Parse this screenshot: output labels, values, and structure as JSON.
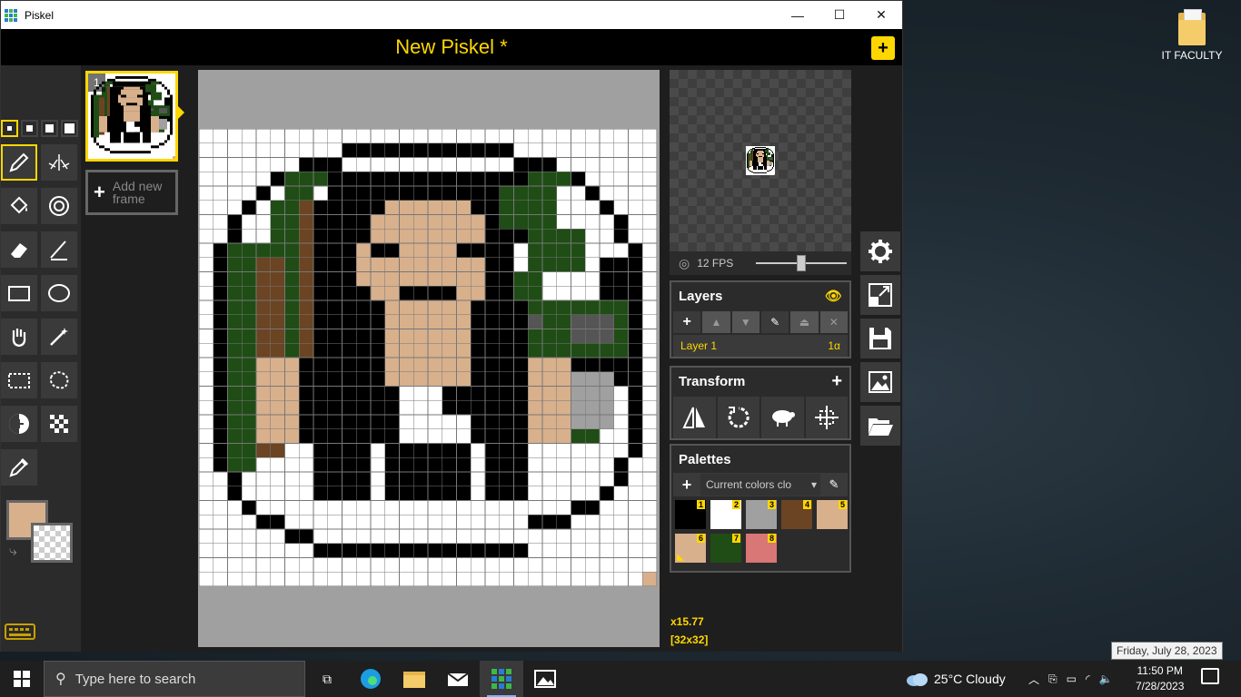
{
  "window": {
    "app_title": "Piskel",
    "minimize": "—",
    "maximize": "☐",
    "close": "✕"
  },
  "header": {
    "title": "New Piskel *",
    "new_button": "+"
  },
  "frames": {
    "frame_number": "1",
    "add_frame_label_1": "Add new",
    "add_frame_label_2": "frame"
  },
  "colors": {
    "primary": "#d8b08c",
    "secondary": "transparent"
  },
  "preview": {
    "fps_label": "12 FPS"
  },
  "layers": {
    "title": "Layers",
    "layer_name": "Layer 1",
    "layer_alpha": "1α"
  },
  "transform": {
    "title": "Transform"
  },
  "palettes": {
    "title": "Palettes",
    "selected": "Current colors clo",
    "swatches": [
      {
        "n": "1",
        "color": "#000000"
      },
      {
        "n": "2",
        "color": "#ffffff"
      },
      {
        "n": "3",
        "color": "#a0a0a0"
      },
      {
        "n": "4",
        "color": "#6b4423"
      },
      {
        "n": "5",
        "color": "#d8b08c"
      },
      {
        "n": "6",
        "color": "#d8b08c"
      },
      {
        "n": "7",
        "color": "#1f4d15"
      },
      {
        "n": "8",
        "color": "#d97676"
      }
    ]
  },
  "status": {
    "zoom": "x15.77",
    "size": "[32x32]"
  },
  "desktop": {
    "icon_label": "IT FACULTY"
  },
  "taskbar": {
    "search_placeholder": "Type here to search",
    "weather": "25°C  Cloudy",
    "time": "11:50 PM",
    "date": "7/28/2023",
    "tooltip": "Friday, July 28, 2023"
  }
}
